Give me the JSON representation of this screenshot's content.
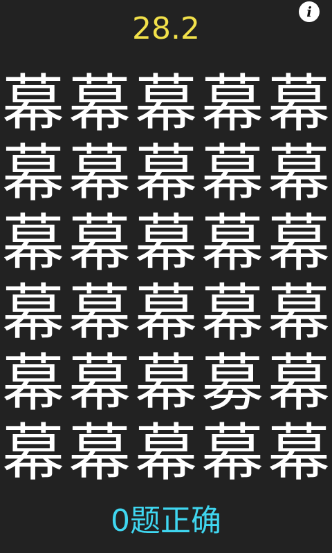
{
  "header": {
    "timer": "28.2",
    "info_label": "i"
  },
  "grid": {
    "columns": 5,
    "rows": [
      [
        "幕",
        "幕",
        "幕",
        "幕",
        "幕"
      ],
      [
        "幕",
        "幕",
        "幕",
        "幕",
        "幕"
      ],
      [
        "幕",
        "幕",
        "幕",
        "幕",
        "幕"
      ],
      [
        "幕",
        "幕",
        "幕",
        "幕",
        "幕"
      ],
      [
        "幕",
        "幕",
        "幕",
        "募",
        "幕"
      ],
      [
        "幕",
        "幕",
        "幕",
        "幕",
        "幕"
      ]
    ]
  },
  "footer": {
    "score": "0题正确"
  },
  "colors": {
    "background": "#222222",
    "timer": "#F2E14A",
    "glyph": "#FFFFFF",
    "score": "#3FD6F0"
  }
}
